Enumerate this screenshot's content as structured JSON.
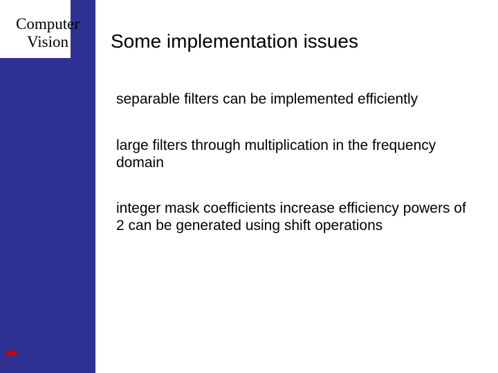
{
  "sidebar": {
    "title_line1": "Computer",
    "title_line2": "Vision"
  },
  "slide": {
    "heading": "Some implementation issues",
    "paragraphs": [
      "separable filters can be implemented efficiently",
      "large filters through multiplication in the frequency domain",
      "integer mask coefficients increase efficiency powers of 2 can be generated using shift operations"
    ]
  },
  "icons": {
    "arrow": "➨"
  }
}
